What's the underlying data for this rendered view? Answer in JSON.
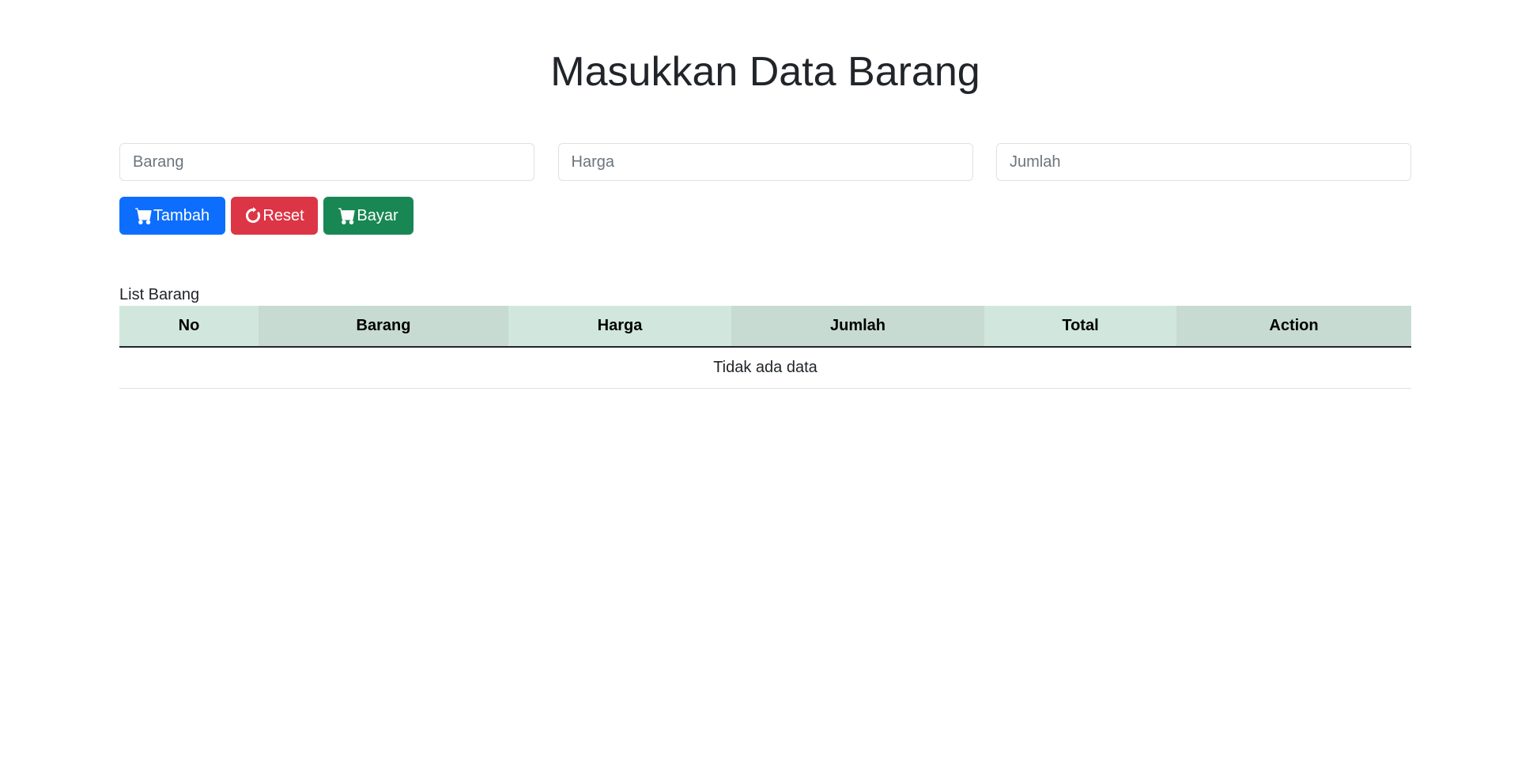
{
  "page": {
    "title": "Masukkan Data Barang"
  },
  "form": {
    "barang_placeholder": "Barang",
    "harga_placeholder": "Harga",
    "jumlah_placeholder": "Jumlah",
    "barang_value": "",
    "harga_value": "",
    "jumlah_value": ""
  },
  "buttons": {
    "tambah": {
      "label": "Tambah",
      "icon": "cart-plus-icon",
      "color": "#0d6efd"
    },
    "reset": {
      "label": "Reset",
      "icon": "refresh-icon",
      "color": "#dc3545"
    },
    "bayar": {
      "label": "Bayar",
      "icon": "cart-icon",
      "color": "#198754"
    }
  },
  "table": {
    "caption": "List Barang",
    "headers": [
      "No",
      "Barang",
      "Harga",
      "Jumlah",
      "Total",
      "Action"
    ],
    "empty_message": "Tidak ada data",
    "header_colors": [
      "#d1e7dd",
      "#c7dbd2"
    ]
  }
}
